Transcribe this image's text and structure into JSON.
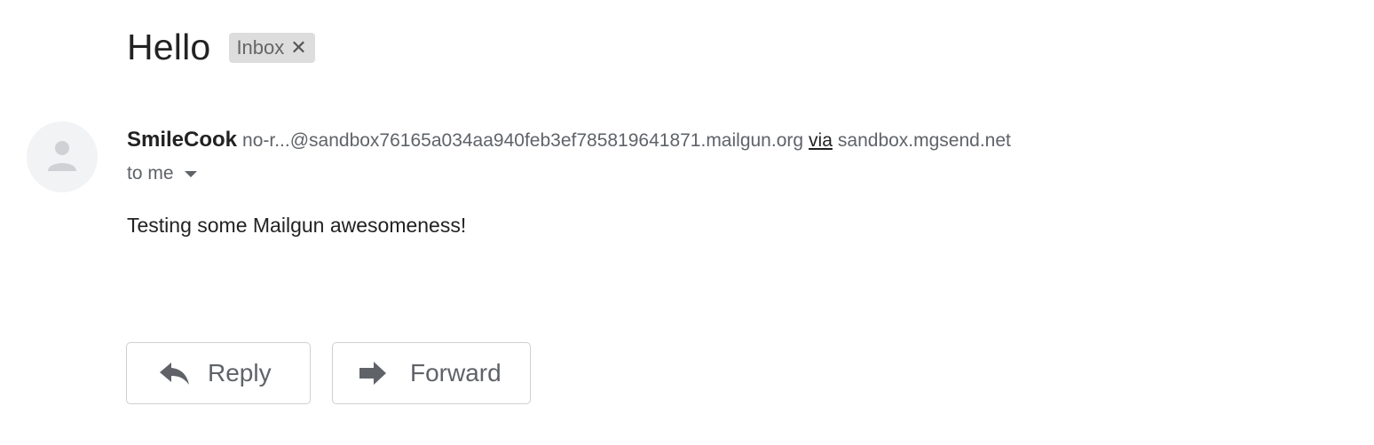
{
  "message": {
    "subject": "Hello",
    "label": "Inbox",
    "label_remove_icon": "close-icon",
    "sender": {
      "name": "SmileCook",
      "email": "no-r...@sandbox76165a034aa940feb3ef785819641871.mailgun.org",
      "via_label": "via",
      "via_domain": "sandbox.mgsend.net",
      "avatar_icon": "person-icon"
    },
    "recipients": "to me",
    "body": "Testing some Mailgun awesomeness!"
  },
  "actions": {
    "reply_label": "Reply",
    "reply_icon": "reply-arrow-icon",
    "forward_label": "Forward",
    "forward_icon": "forward-arrow-icon"
  },
  "colors": {
    "label_chip_bg": "#dddddd",
    "secondary_text": "#5f6368",
    "primary_text": "#222222",
    "avatar_bg": "#f1f3f4",
    "avatar_fg": "#cfd1d4"
  }
}
